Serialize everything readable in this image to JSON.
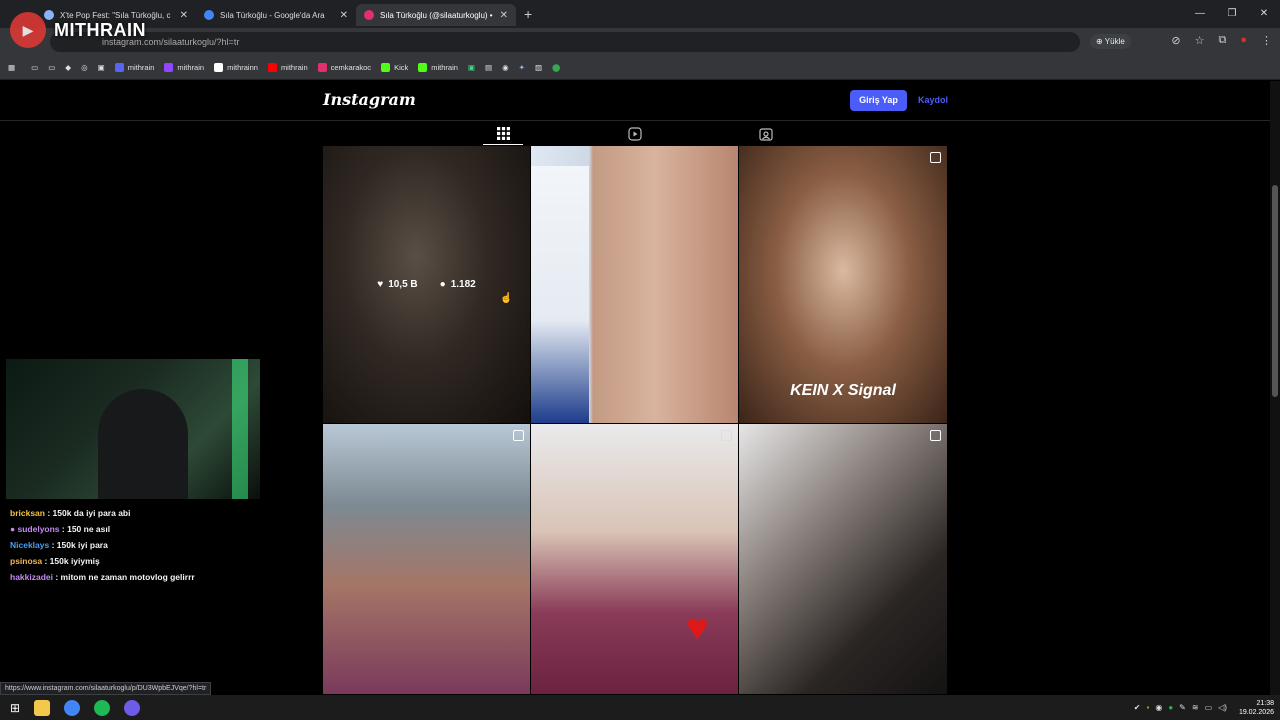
{
  "browser": {
    "tabs": [
      {
        "title": "X'te Pop Fest: \"Sıla Türkoğlu, c",
        "color": "#8ab4f8"
      },
      {
        "title": "Sıla Türkoğlu - Google'da Ara",
        "color": "#4285f4"
      },
      {
        "title": "Sıla Türkoğlu (@silaaturkoglu) •",
        "color": "#e1306c"
      }
    ],
    "new_tab": "+",
    "url": "instagram.com/silaaturkoglu/?hl=tr",
    "install_label": "Yükle",
    "bookmarks": [
      {
        "label": "mithrain",
        "color": "#5865f2"
      },
      {
        "label": "mithrain",
        "color": "#9146ff"
      },
      {
        "label": "mithrainn",
        "color": "#ffffff"
      },
      {
        "label": "mithrain",
        "color": "#ff0000"
      },
      {
        "label": "cemkarakoc",
        "color": "#e1306c"
      },
      {
        "label": "Kick",
        "color": "#53fc18"
      },
      {
        "label": "mithrain",
        "color": "#53fc18"
      }
    ]
  },
  "overlay": {
    "brand": "MITHRAIN"
  },
  "instagram": {
    "logo": "Instagram",
    "login_label": "Giriş Yap",
    "signup_label": "Kaydol",
    "hover_likes": "10,5 B",
    "hover_comments": "1.182",
    "overlay_text": "KEIN X Signal"
  },
  "chat": [
    {
      "user": "bricksan",
      "msg": " : 150k da iyi para abi",
      "color": "#f5c542"
    },
    {
      "user": "sudelyons",
      "msg": " : 150 ne asıl",
      "color": "#c38bf0"
    },
    {
      "user": "Niceklays",
      "msg": " : 150k iyi para",
      "color": "#4a9ff5"
    },
    {
      "user": "psinosa",
      "msg": " : 150k iyiymiş",
      "color": "#f0b95a"
    },
    {
      "user": "hakkizadei",
      "msg": " : mitom ne zaman motovlog gelirrr",
      "color": "#c38bf0"
    }
  ],
  "status_url": "https://www.instagram.com/silaaturkoglu/p/DU3WpbEJVqe/?hl=tr",
  "clock": {
    "time": "21:38",
    "date": "19.02.2026"
  }
}
